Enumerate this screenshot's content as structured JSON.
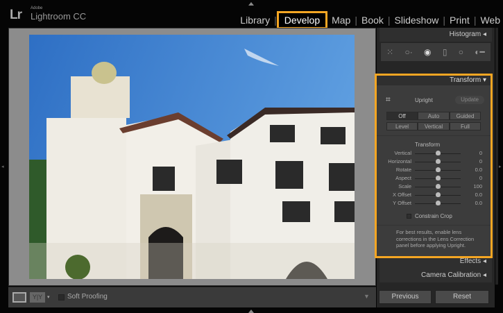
{
  "app": {
    "brand": "Lr",
    "vendor": "Adobe",
    "name": "Lightroom CC"
  },
  "modules": [
    {
      "label": "Library"
    },
    {
      "label": "Develop",
      "active": true
    },
    {
      "label": "Map"
    },
    {
      "label": "Book"
    },
    {
      "label": "Slideshow"
    },
    {
      "label": "Print"
    },
    {
      "label": "Web"
    }
  ],
  "panel": {
    "histogram": "Histogram",
    "tools": [
      "grid-overlay-icon",
      "crop-icon",
      "spot-removal-icon",
      "graduated-filter-icon",
      "radial-filter-icon",
      "adjustment-brush-icon"
    ],
    "transform": {
      "title": "Transform",
      "upright_label": "Upright",
      "update": "Update",
      "upright_modes": [
        "Off",
        "Auto",
        "Guided",
        "Level",
        "Vertical",
        "Full"
      ],
      "selected_mode": "Off",
      "section": "Transform",
      "sliders": [
        {
          "label": "Vertical",
          "value": "0"
        },
        {
          "label": "Horizontal",
          "value": "0"
        },
        {
          "label": "Rotate",
          "value": "0.0"
        },
        {
          "label": "Aspect",
          "value": "0"
        },
        {
          "label": "Scale",
          "value": "100"
        },
        {
          "label": "X Offset",
          "value": "0.0"
        },
        {
          "label": "Y Offset",
          "value": "0.0"
        }
      ],
      "constrain_crop": "Constrain Crop",
      "note": "For best results, enable lens corrections in the Lens Correction panel before applying Upright."
    },
    "effects": "Effects",
    "camera_calibration": "Camera Calibration",
    "previous": "Previous",
    "reset": "Reset"
  },
  "toolbar": {
    "soft_proofing": "Soft Proofing",
    "before_after": "Y|Y"
  },
  "colors": {
    "highlight": "#f5a623",
    "sky": "#3f7fcf"
  }
}
